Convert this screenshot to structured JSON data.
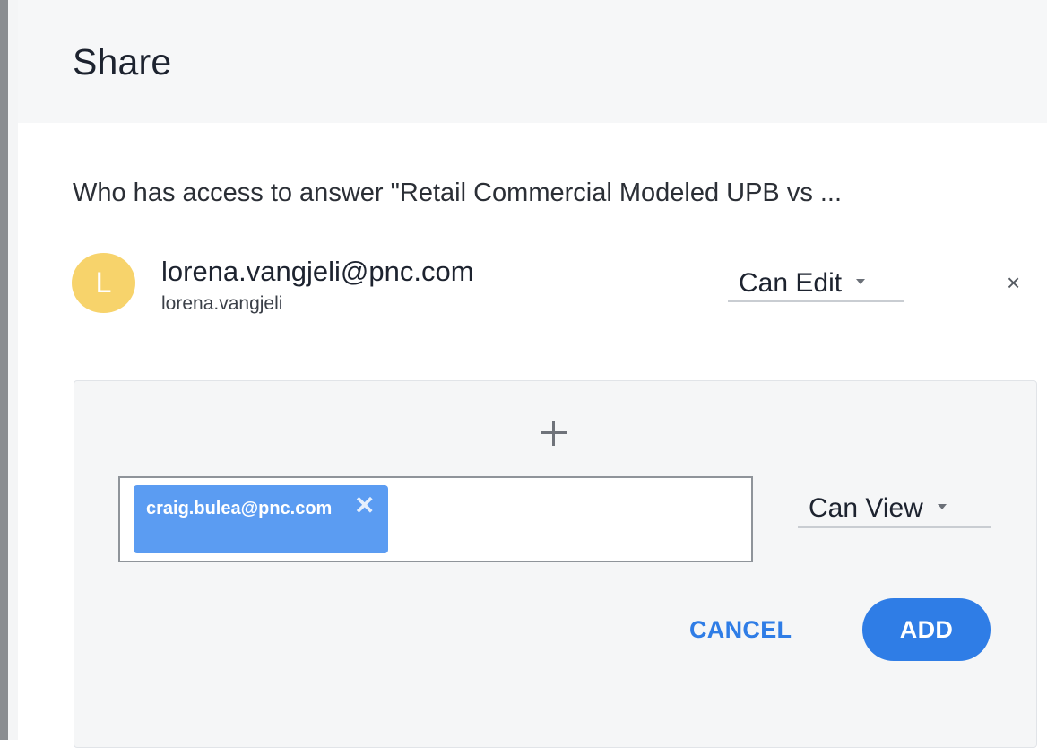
{
  "dialog": {
    "title": "Share"
  },
  "access": {
    "text": "Who has access to answer \"Retail Commercial Modeled UPB vs ..."
  },
  "user": {
    "avatar_initial": "L",
    "email": "lorena.vangjeli@pnc.com",
    "username": "lorena.vangjeli",
    "permission": "Can Edit",
    "remove_symbol": "×"
  },
  "add_panel": {
    "chip_text": "craig.bulea@pnc.com",
    "chip_remove_symbol": "✕",
    "permission": "Can View",
    "cancel_label": "CANCEL",
    "add_label": "ADD"
  },
  "icons": {
    "plus": "plus-icon",
    "caret": "caret-down-icon",
    "close": "close-icon"
  },
  "colors": {
    "avatar": "#f7d36b",
    "chip": "#5b9cf2",
    "primary": "#2f7de6"
  }
}
